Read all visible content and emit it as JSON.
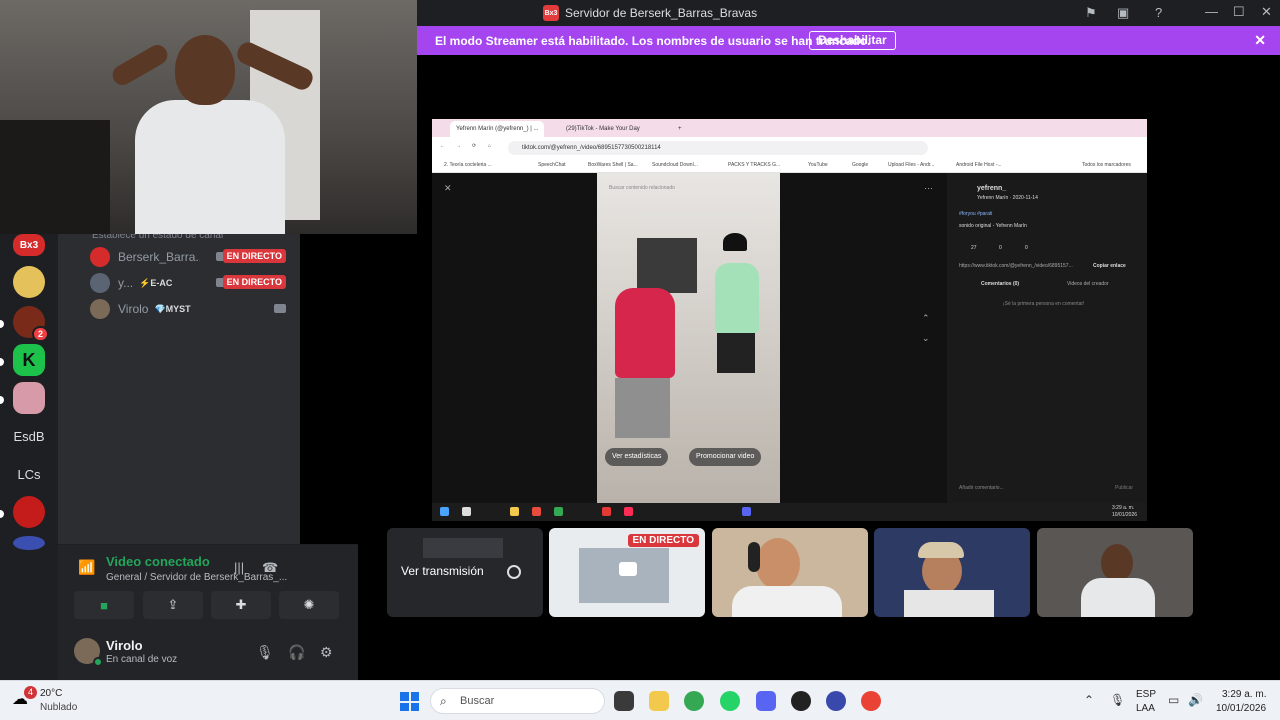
{
  "window": {
    "title": "Servidor de Berserk_Barras_Bravas",
    "logo_text": "Bx3"
  },
  "streamer_banner": {
    "message": "El modo Streamer está habilitado. Los nombres de usuario se han truncado.",
    "button": "Deshabilitar"
  },
  "sidebar": {
    "text_servers": [
      "EsdB",
      "LCs"
    ],
    "server_badge": "2"
  },
  "channel": {
    "status_hint": "Establece un estado de canal",
    "members": [
      {
        "name": "Berserk_Barra...",
        "tag": "",
        "live": "EN DIRECTO"
      },
      {
        "name": "y...",
        "tag": "⚡E-AC",
        "live": "EN DIRECTO"
      },
      {
        "name": "Virolo",
        "tag": "💎MYST",
        "live": ""
      }
    ]
  },
  "voice": {
    "status": "Video conectado",
    "location": "General / Servidor de Berserk_Barras_..."
  },
  "user": {
    "name": "Virolo",
    "status": "En canal de voz"
  },
  "browser": {
    "tabs": [
      "Yefrenn Marín (@yefrenn_) | ...",
      "(29)TikTok - Make Your Day"
    ],
    "url": "tiktok.com/@yefrenn_/video/6895157730500218114",
    "bookmarks": [
      "2. Teoría cocteleria ...",
      "SpeechChat",
      "BoxWares Shell | Sa...",
      "Soundcloud Downl...",
      "PACKS Y TRACKS G...",
      "YouTube",
      "Google",
      "Upload Files - Andr...",
      "Android File Host -...",
      "Todos los marcadores"
    ],
    "video_search": "Buscar contenido relacionado",
    "btn_stats": "Ver estadísticas",
    "btn_promote": "Promocionar video",
    "author": "yefrenn_",
    "author_sub": "Yefrenn Marín · 2020-11-14",
    "hashtags": "#foryou #parati",
    "sound": "sonido original - Yefrenn Marín",
    "counts": [
      "27",
      "0",
      "0"
    ],
    "link": "https://www.tiktok.com/@yefrenn_/video/6895157...",
    "copy_link": "Copiar enlace",
    "tab_comments": "Comentarios (0)",
    "tab_creator": "Videos del creador",
    "empty_comments": "¡Sé la primera persona en comentar!",
    "add_comment": "Añadir comentario...",
    "publish": "Publicar",
    "clock": "3:29 a. m.",
    "clock_date": "10/01/2026"
  },
  "tiles": {
    "watch_stream": "Ver transmisión",
    "live": "EN DIRECTO"
  },
  "taskbar": {
    "temp": "20°C",
    "weather": "Nublado",
    "weather_badge": "4",
    "search": "Buscar",
    "lang1": "ESP",
    "lang2": "LAA",
    "time": "3:29 a. m.",
    "date": "10/01/2026"
  },
  "colors": {
    "streamer_purple": "#a445f0",
    "live_red": "#da373c",
    "discord_green": "#23a55a",
    "sidebar_bg": "#2b2d31"
  }
}
